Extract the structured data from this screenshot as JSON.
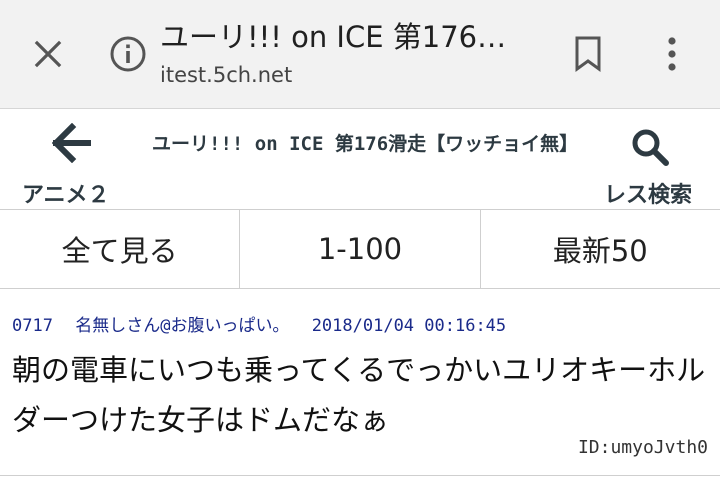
{
  "browser": {
    "page_title": "ユーリ!!! on ICE 第176…",
    "url": "itest.5ch.net",
    "icons": {
      "close": "close-icon",
      "info": "info-icon",
      "bookmark": "bookmark-icon",
      "menu": "more-vert-icon"
    }
  },
  "header": {
    "back_label": "アニメ２",
    "thread_title": "ユーリ!!! on ICE 第176滑走【ワッチョイ無】",
    "search_label": "レス検索",
    "accent_color": "#2d3a42"
  },
  "tabs": [
    {
      "label": "全て見る"
    },
    {
      "label": "1-100"
    },
    {
      "label": "最新50"
    }
  ],
  "post": {
    "number": "0717",
    "name": "名無しさん@お腹いっぱい。",
    "date": "2018/01/04 00:16:45",
    "body": "朝の電車にいつも乗ってくるでっかいユリオキーホルダーつけた女子はドムだなぁ",
    "id": "ID:umyoJvth0",
    "meta_color": "#1a2a8a"
  }
}
